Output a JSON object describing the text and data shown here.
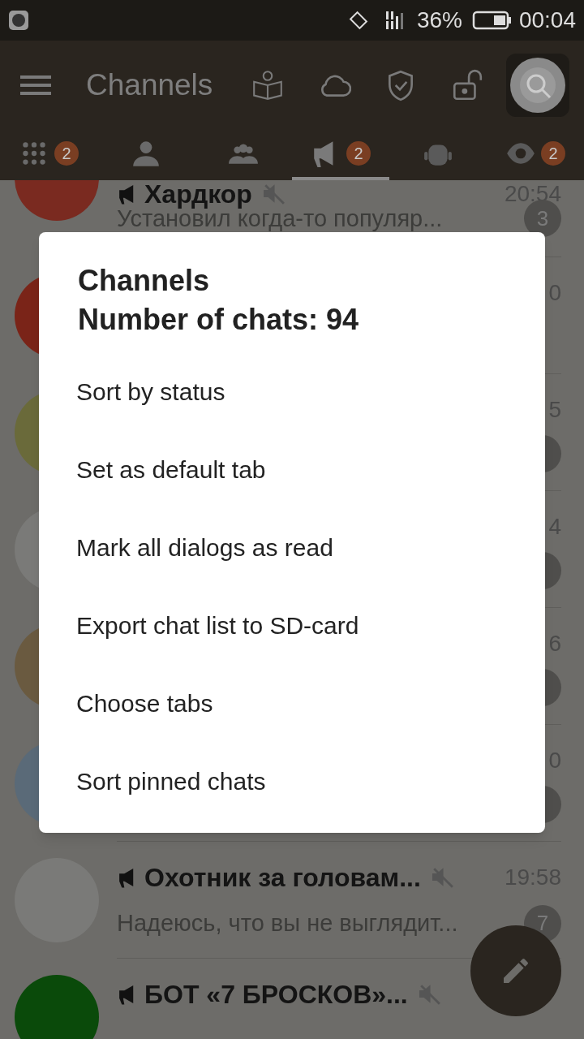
{
  "status_bar": {
    "battery": "36%",
    "time": "00:04"
  },
  "toolbar": {
    "title": "Channels"
  },
  "tabs": [
    {
      "kind": "all",
      "badge": "2",
      "selected": false
    },
    {
      "kind": "user",
      "selected": false
    },
    {
      "kind": "group",
      "selected": false
    },
    {
      "kind": "channel",
      "badge": "2",
      "selected": true
    },
    {
      "kind": "bot",
      "selected": false
    },
    {
      "kind": "eye",
      "badge": "2",
      "selected": false
    }
  ],
  "chats": [
    {
      "name": "Хардкор",
      "muted": true,
      "time": "20:54",
      "preview": "Установил когда-то популяр...",
      "unread": "3",
      "color": "#7a2a20"
    },
    {
      "time": "0",
      "badge": false,
      "color": "#7a2418"
    },
    {
      "time": "5",
      "badge": true,
      "color": "#6a6a3a"
    },
    {
      "time": "4",
      "badge": true,
      "color": "#7a7a78"
    },
    {
      "time": "6",
      "badge": true,
      "color": "#6a5a40"
    },
    {
      "time": "0",
      "badge": true,
      "color": "#5a6a78"
    },
    {
      "name": "Охотник за головам...",
      "muted": true,
      "time": "19:58",
      "preview": "Надеюсь, что вы не выглядит...",
      "unread": "7",
      "color": "#7a7a78"
    },
    {
      "name": "БОТ «7 БРОСКОВ»...",
      "muted": true,
      "color": "#0a4a0a"
    }
  ],
  "dialog": {
    "title": "Channels",
    "subtitle": "Number of chats: 94",
    "items": [
      "Sort by status",
      "Set as default tab",
      "Mark all dialogs as read",
      "Export chat list to SD-card",
      "Choose tabs",
      "Sort pinned chats"
    ]
  }
}
